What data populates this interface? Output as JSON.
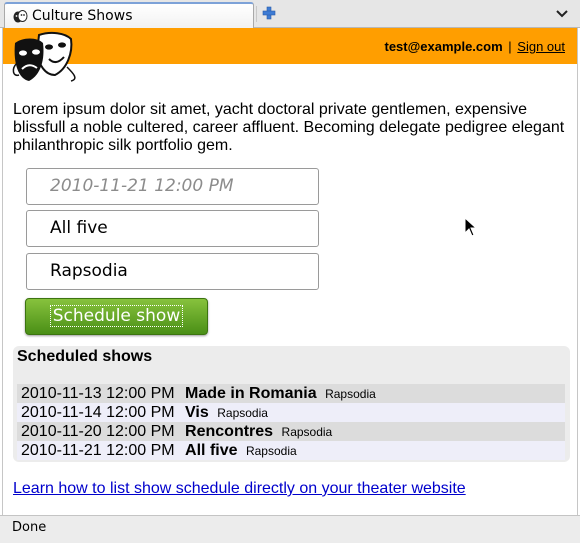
{
  "browser": {
    "tab_title": "Culture Shows",
    "status": "Done"
  },
  "header": {
    "user_email": "test@example.com",
    "separator": "|",
    "sign_out": "Sign out",
    "accent_color": "#ff9e00"
  },
  "intro_text": "Lorem ipsum dolor sit amet, yacht doctoral private gentlemen, expensive blissfull a noble cultered, career affluent. Becoming delegate pedigree elegant philanthropic silk portfolio gem.",
  "form": {
    "datetime_placeholder": "2010-11-21 12:00 PM",
    "show_value": "All five",
    "venue_value": "Rapsodia",
    "schedule_label": "Schedule show"
  },
  "schedule": {
    "title": "Scheduled shows",
    "rows": [
      {
        "date": "2010-11-13 12:00 PM",
        "name": "Made in Romania",
        "venue": "Rapsodia"
      },
      {
        "date": "2010-11-14 12:00 PM",
        "name": "Vis",
        "venue": "Rapsodia"
      },
      {
        "date": "2010-11-20 12:00 PM",
        "name": "Rencontres",
        "venue": "Rapsodia"
      },
      {
        "date": "2010-11-21 12:00 PM",
        "name": "All five",
        "venue": "Rapsodia"
      }
    ]
  },
  "learn_link": "Learn how to list show schedule directly on your theater website"
}
